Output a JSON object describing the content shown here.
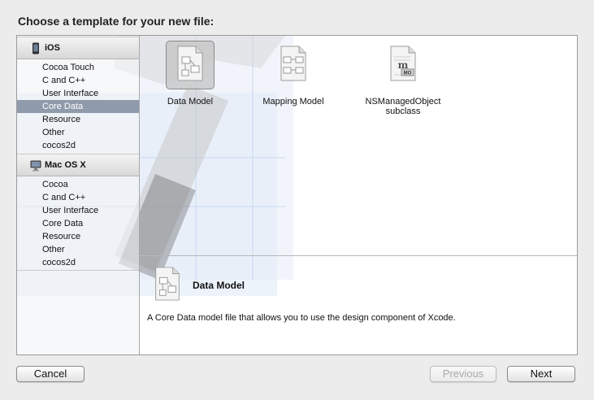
{
  "dialog": {
    "title": "Choose a template for your new file:"
  },
  "sidebar": {
    "groups": [
      {
        "name": "iOS",
        "icon": "iphone-icon",
        "items": [
          "Cocoa Touch",
          "C and C++",
          "User Interface",
          "Core Data",
          "Resource",
          "Other",
          "cocos2d"
        ],
        "selected": "Core Data"
      },
      {
        "name": "Mac OS X",
        "icon": "mac-icon",
        "items": [
          "Cocoa",
          "C and C++",
          "User Interface",
          "Core Data",
          "Resource",
          "Other",
          "cocos2d"
        ]
      }
    ]
  },
  "templates": [
    {
      "label": "Data Model",
      "icon": "data-model-icon",
      "selected": true
    },
    {
      "label": "Mapping Model",
      "icon": "mapping-model-icon",
      "selected": false
    },
    {
      "label": "NSManagedObject",
      "label2": "subclass",
      "icon": "managed-object-icon",
      "icon_text": "m",
      "icon_badge": "MO",
      "selected": false
    }
  ],
  "detail": {
    "title": "Data Model",
    "description": "A Core Data model file that allows you to use the design component of Xcode."
  },
  "buttons": {
    "cancel": "Cancel",
    "previous": "Previous",
    "next": "Next"
  },
  "colors": {
    "selection": "#8f9aab",
    "dialog_background": "#ececec"
  }
}
